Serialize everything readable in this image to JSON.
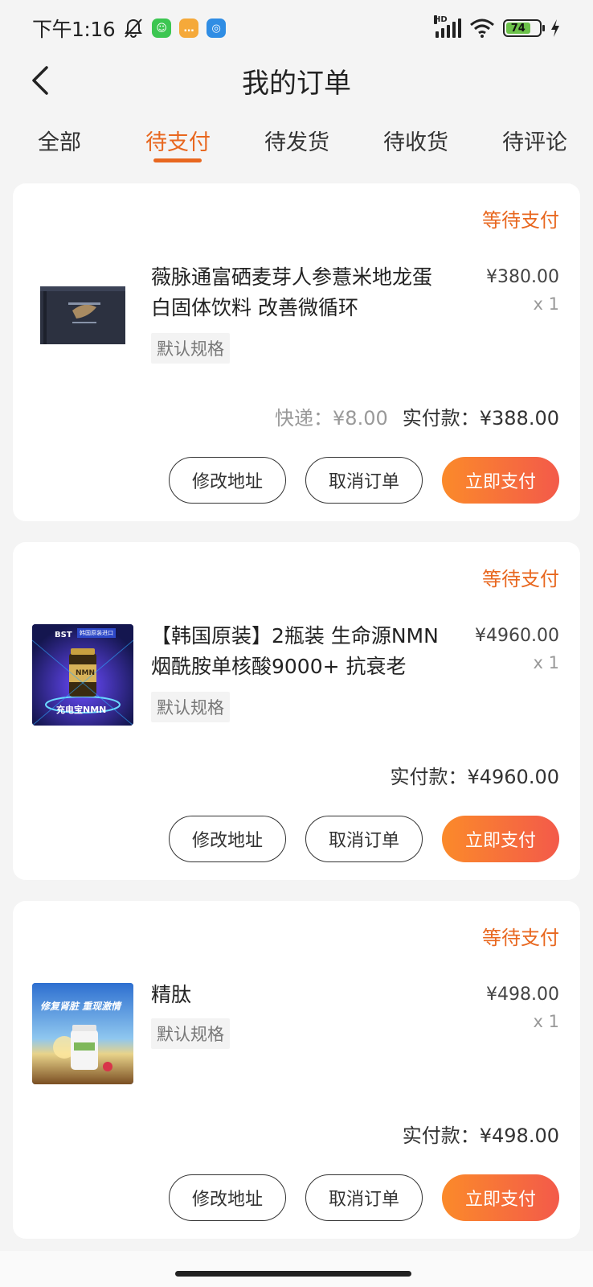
{
  "status_bar": {
    "time": "下午1:16",
    "hd_label": "HD",
    "battery": "74",
    "icons": [
      "bell-muted-icon",
      "app-green-icon",
      "message-yellow-icon",
      "browser-blue-icon",
      "signal-icon",
      "wifi-icon",
      "battery-icon",
      "charging-icon"
    ]
  },
  "header": {
    "title": "我的订单",
    "back_icon": "chevron-left-icon"
  },
  "tabs": [
    {
      "label": "全部"
    },
    {
      "label": "待支付"
    },
    {
      "label": "待发货"
    },
    {
      "label": "待收货"
    },
    {
      "label": "待评论"
    }
  ],
  "active_tab": 1,
  "accent": "#e8671f",
  "orders": [
    {
      "status": "等待支付",
      "product_name": "薇脉通富硒麦芽人参薏米地龙蛋白固体饮料 改善微循环",
      "spec": "默认规格",
      "price": "¥380.00",
      "qty": "x 1",
      "shipping": "快递：¥8.00",
      "total": "实付款：¥388.00",
      "buttons": {
        "address": "修改地址",
        "cancel": "取消订单",
        "pay": "立即支付"
      }
    },
    {
      "status": "等待支付",
      "product_name": "【韩国原装】2瓶装 生命源NMN 烟酰胺单核酸9000+ 抗衰老",
      "spec": "默认规格",
      "price": "¥4960.00",
      "qty": "x 1",
      "total": "实付款：¥4960.00",
      "thumb_text": {
        "brand": "BST",
        "badge": "韩国原装进口",
        "label": "NMN",
        "slogan": "充电宝NMN"
      },
      "buttons": {
        "address": "修改地址",
        "cancel": "取消订单",
        "pay": "立即支付"
      }
    },
    {
      "status": "等待支付",
      "product_name": "精肽",
      "spec": "默认规格",
      "price": "¥498.00",
      "qty": "x 1",
      "total": "实付款：¥498.00",
      "thumb_text": {
        "slogan": "修复肾脏 重现激情"
      },
      "buttons": {
        "address": "修改地址",
        "cancel": "取消订单",
        "pay": "立即支付"
      }
    }
  ]
}
